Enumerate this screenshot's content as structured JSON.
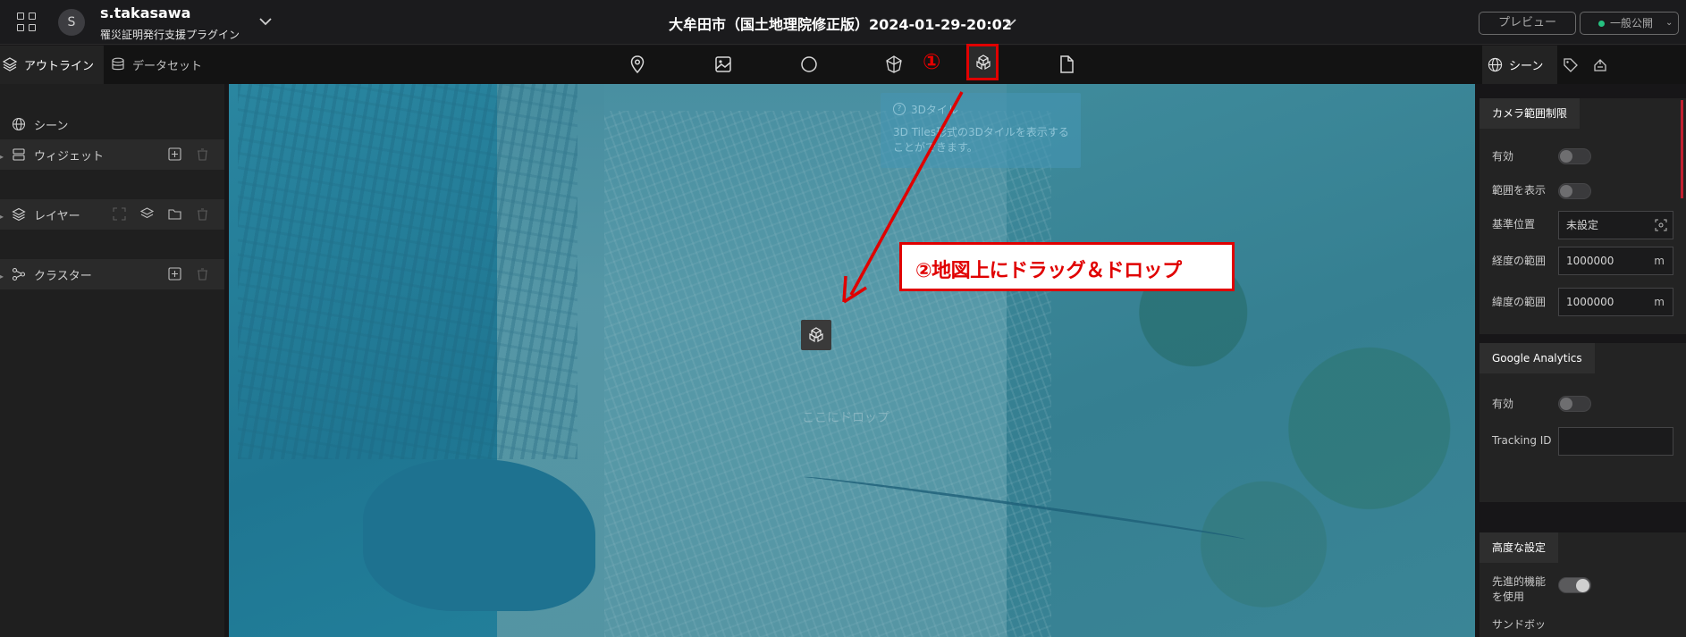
{
  "header": {
    "user_initial": "S",
    "user_name": "s.takasawa",
    "project_name": "罹災証明発行支援プラグイン",
    "scene_title": "大牟田市（国土地理院修正版）2024-01-29-20:02",
    "preview_label": "プレビュー",
    "publish_label": "一般公開",
    "publish_status_color": "#26c281"
  },
  "toolbar": {
    "left_tabs": [
      {
        "label": "アウトライン",
        "icon": "layers-icon"
      },
      {
        "label": "データセット",
        "icon": "database-icon"
      }
    ],
    "tools": [
      "marker-icon",
      "image-icon",
      "circle-icon",
      "polygon-3d-icon",
      "3d-tiles-icon",
      "file-icon"
    ],
    "step_badge": "①",
    "right_tabs": [
      {
        "label": "シーン",
        "icon": "globe-icon"
      },
      {
        "label": "",
        "icon": "tag-icon"
      },
      {
        "label": "",
        "icon": "palette-icon"
      }
    ]
  },
  "outline": {
    "items": [
      {
        "label": "シーン",
        "icon": "globe-icon"
      },
      {
        "label": "ウィジェット",
        "icon": "widget-icon"
      },
      {
        "label": "レイヤー",
        "icon": "layers-icon"
      },
      {
        "label": "クラスター",
        "icon": "cluster-icon"
      }
    ]
  },
  "map": {
    "tooltip_title": "3Dタイル",
    "tooltip_desc": "3D Tiles形式の3Dタイルを表示することができます。",
    "drop_hint": "ここにドロップ",
    "callout_text": "②地図上にドラッグ＆ドロップ",
    "annotation_color": "#e00000"
  },
  "right_panel": {
    "camera": {
      "title": "カメラ範囲制限",
      "enabled_label": "有効",
      "show_range_label": "範囲を表示",
      "base_position_label": "基準位置",
      "base_position_value": "未設定",
      "lng_range_label": "経度の範囲",
      "lng_range_value": "1000000",
      "lat_range_label": "緯度の範囲",
      "lat_range_value": "1000000",
      "unit": "m"
    },
    "analytics": {
      "title": "Google Analytics",
      "enabled_label": "有効",
      "tracking_label": "Tracking ID",
      "tracking_value": ""
    },
    "advanced": {
      "title": "高度な設定",
      "experimental_label_1": "先進的機能",
      "experimental_label_2": "を使用",
      "experimental_on": true,
      "sandbox_label": "サンドボッ"
    }
  }
}
